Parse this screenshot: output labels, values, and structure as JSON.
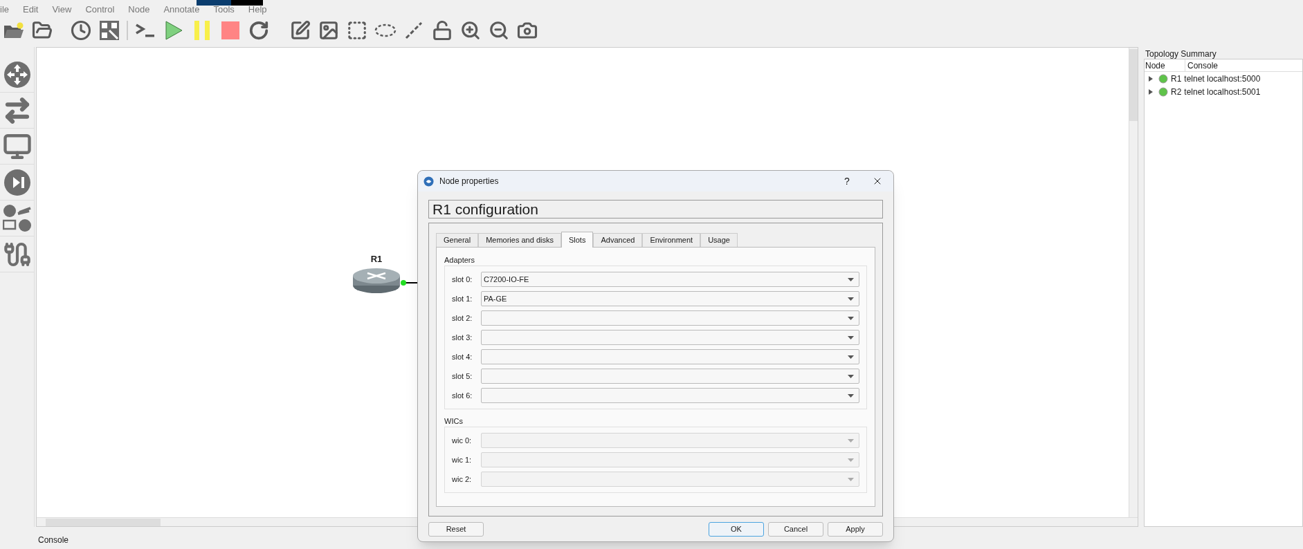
{
  "menu": [
    {
      "label": "ile"
    },
    {
      "label": "Edit"
    },
    {
      "label": "View"
    },
    {
      "label": "Control"
    },
    {
      "label": "Node"
    },
    {
      "label": "Annotate"
    },
    {
      "label": "Tools"
    },
    {
      "label": "Help"
    }
  ],
  "canvas": {
    "nodes": [
      {
        "label": "R1"
      }
    ]
  },
  "topology_summary": {
    "title": "Topology Summary",
    "columns": [
      "Node",
      "Console"
    ],
    "rows": [
      {
        "node": "R1",
        "console": "telnet localhost:5000",
        "expanded": false
      },
      {
        "node": "R2",
        "console": "telnet localhost:5001",
        "expanded": false
      }
    ]
  },
  "dialog": {
    "title": "Node properties",
    "help": "?",
    "heading": "R1 configuration",
    "tabs": [
      {
        "label": "General",
        "selected": false
      },
      {
        "label": "Memories and disks",
        "selected": false
      },
      {
        "label": "Slots",
        "selected": true
      },
      {
        "label": "Advanced",
        "selected": false
      },
      {
        "label": "Environment",
        "selected": false
      },
      {
        "label": "Usage",
        "selected": false
      }
    ],
    "groups": [
      {
        "title": "Adapters",
        "rows": [
          {
            "label": "slot 0:",
            "value": "C7200-IO-FE",
            "disabled": false
          },
          {
            "label": "slot 1:",
            "value": "PA-GE",
            "disabled": false
          },
          {
            "label": "slot 2:",
            "disabled": false
          },
          {
            "label": "slot 3:",
            "disabled": false
          },
          {
            "label": "slot 4:",
            "disabled": false
          },
          {
            "label": "slot 5:",
            "disabled": false
          },
          {
            "label": "slot 6:",
            "disabled": false
          }
        ]
      },
      {
        "title": "WICs",
        "rows": [
          {
            "label": "wic 0:",
            "disabled": true
          },
          {
            "label": "wic 1:",
            "disabled": true
          },
          {
            "label": "wic 2:",
            "disabled": true
          }
        ]
      }
    ],
    "buttons": [
      {
        "label": "Reset",
        "default": false
      },
      {
        "label": "OK",
        "default": true
      },
      {
        "label": "Cancel",
        "default": false
      },
      {
        "label": "Apply",
        "default": false
      }
    ]
  },
  "console": {
    "title": "Console"
  }
}
